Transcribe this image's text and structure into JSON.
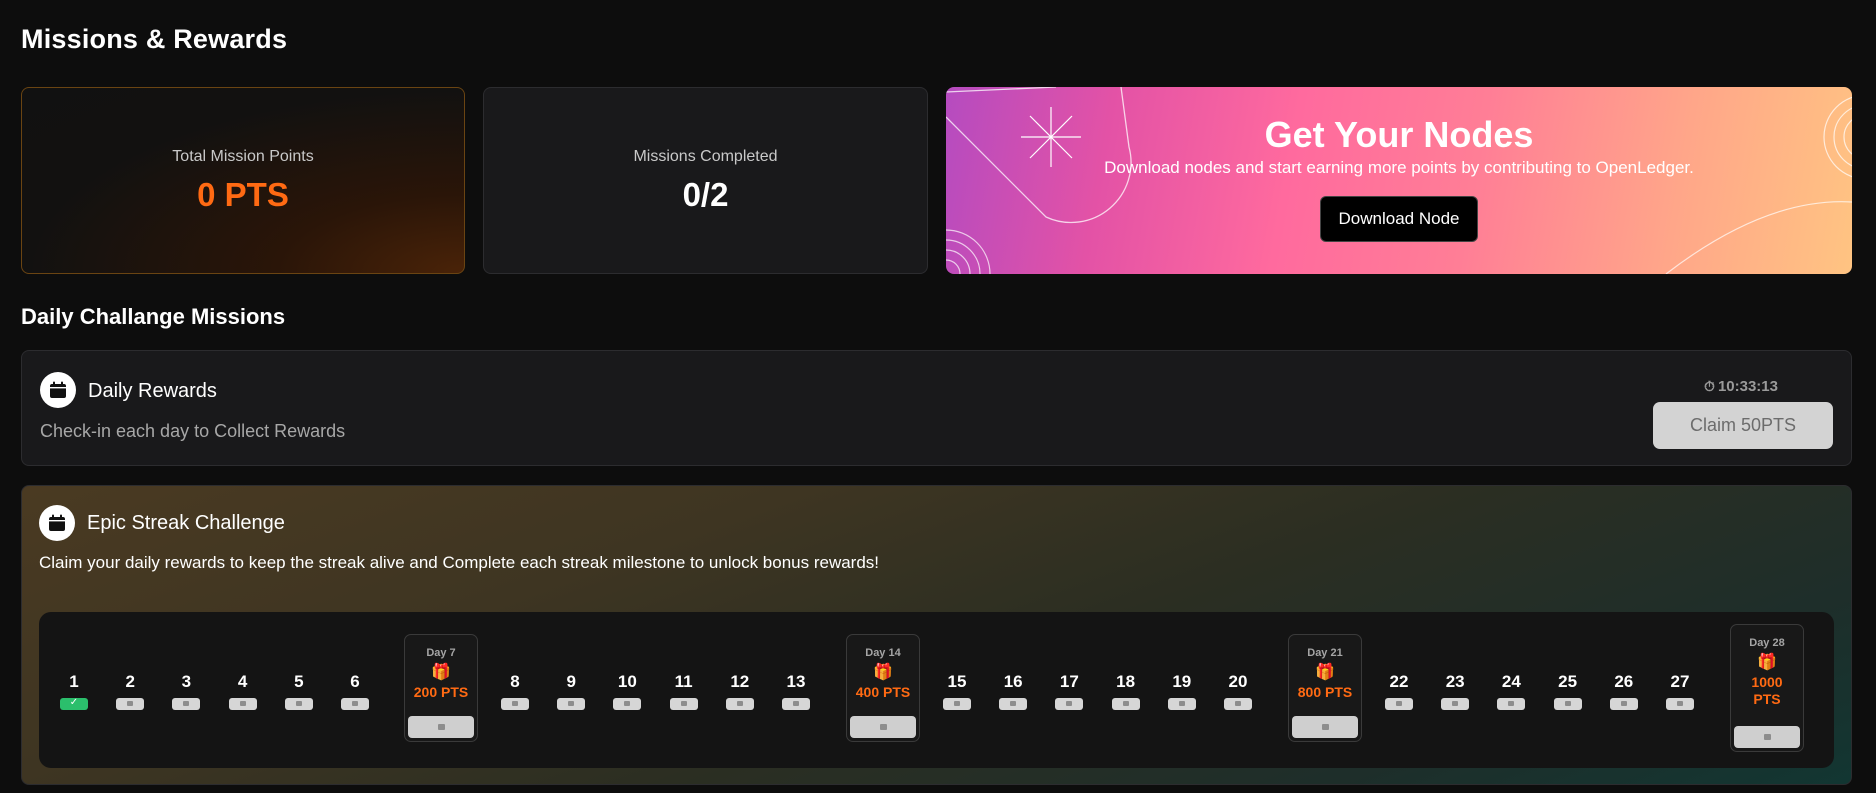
{
  "page": {
    "title": "Missions & Rewards"
  },
  "stats": {
    "points_label": "Total Mission Points",
    "points_value": "0 PTS",
    "completed_label": "Missions Completed",
    "completed_value": "0/2"
  },
  "promo": {
    "title": "Get Your Nodes",
    "subtitle": "Download nodes and start earning more points by contributing to OpenLedger.",
    "button_label": "Download Node"
  },
  "section": {
    "title": "Daily Challange Missions"
  },
  "daily": {
    "icon": "calendar-icon",
    "title": "Daily Rewards",
    "description": "Check-in each day to Collect Rewards",
    "timer": "10:33:13",
    "claim_label": "Claim 50PTS"
  },
  "streak": {
    "icon": "calendar-icon",
    "title": "Epic Streak Challenge",
    "description": "Claim your daily rewards to keep the streak alive and Complete each streak milestone to unlock bonus rewards!",
    "days": [
      "1",
      "2",
      "3",
      "4",
      "5",
      "6",
      "8",
      "9",
      "10",
      "11",
      "12",
      "13",
      "15",
      "16",
      "17",
      "18",
      "19",
      "20",
      "22",
      "23",
      "24",
      "25",
      "26",
      "27"
    ],
    "completed_days": [
      "1"
    ],
    "milestones": [
      {
        "label": "Day 7",
        "points": "200 PTS"
      },
      {
        "label": "Day 14",
        "points": "400 PTS"
      },
      {
        "label": "Day 21",
        "points": "800 PTS"
      },
      {
        "label": "Day 28",
        "points": "1000 PTS"
      }
    ]
  },
  "colors": {
    "accent_orange": "#ff6a13",
    "success_green": "#2bbf6c",
    "background": "#0d0d0d"
  }
}
